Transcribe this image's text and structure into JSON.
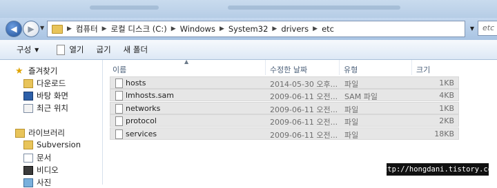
{
  "address_bar": {
    "breadcrumbs": [
      "컴퓨터",
      "로컬 디스크 (C:)",
      "Windows",
      "System32",
      "drivers",
      "etc"
    ],
    "search_placeholder": "etc"
  },
  "toolbar": {
    "organize_label": "구성",
    "open_label": "열기",
    "share_label": "굽기",
    "new_folder_label": "새 폴더"
  },
  "nav_pane": {
    "favorites_label": "즐겨찾기",
    "favorites": [
      "다운로드",
      "바탕 화면",
      "최근 위치"
    ],
    "libraries_label": "라이브러리",
    "libraries": [
      "Subversion",
      "문서",
      "비디오",
      "사진"
    ]
  },
  "columns": {
    "name": "이름",
    "date": "수정한 날짜",
    "type": "유형",
    "size": "크기"
  },
  "files": [
    {
      "name": "hosts",
      "date": "2014-05-30 오후...",
      "type": "파일",
      "size": "1KB"
    },
    {
      "name": "lmhosts.sam",
      "date": "2009-06-11 오전...",
      "type": "SAM 파일",
      "size": "4KB"
    },
    {
      "name": "networks",
      "date": "2009-06-11 오전...",
      "type": "파일",
      "size": "1KB"
    },
    {
      "name": "protocol",
      "date": "2009-06-11 오전...",
      "type": "파일",
      "size": "2KB"
    },
    {
      "name": "services",
      "date": "2009-06-11 오전...",
      "type": "파일",
      "size": "18KB"
    }
  ],
  "watermark": "http://hongdani.tistory.com"
}
